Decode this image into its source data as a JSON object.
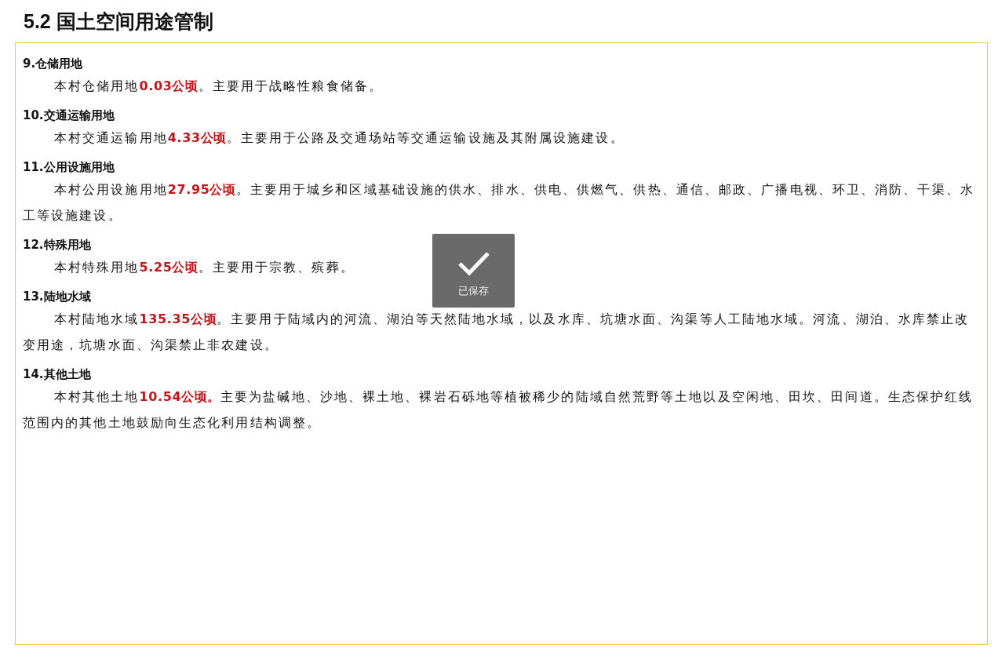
{
  "title": "5.2 国土空间用途管制",
  "sections": [
    {
      "heading": "9.仓储用地",
      "before": "本村仓储用地",
      "amount": "0.03公顷",
      "after": "。主要用于战略性粮食储备。"
    },
    {
      "heading": "10.交通运输用地",
      "before": "本村交通运输用地",
      "amount": "4.33公顷",
      "after": "。主要用于公路及交通场站等交通运输设施及其附属设施建设。"
    },
    {
      "heading": "11.公用设施用地",
      "before": "本村公用设施用地",
      "amount": "27.95公顷",
      "after": "。主要用于城乡和区域基础设施的供水、排水、供电、供燃气、供热、通信、邮政、广播电视、环卫、消防、干渠、水工等设施建设。"
    },
    {
      "heading": "12.特殊用地",
      "before": "本村特殊用地",
      "amount": "5.25公顷",
      "after": "。主要用于宗教、殡葬。"
    },
    {
      "heading": "13.陆地水域",
      "before": "本村陆地水域",
      "amount": "135.35公顷",
      "after": "。主要用于陆域内的河流、湖泊等天然陆地水域，以及水库、坑塘水面、沟渠等人工陆地水域。河流、湖泊、水库禁止改变用途，坑塘水面、沟渠禁止非农建设。"
    },
    {
      "heading": "14.其他土地",
      "before": "本村其他土地",
      "amount": "10.54公顷。",
      "after": "主要为盐碱地、沙地、裸土地、裸岩石砾地等植被稀少的陆域自然荒野等土地以及空闲地、田坎、田间道。生态保护红线范围内的其他土地鼓励向生态化利用结构调整。"
    }
  ],
  "toast": {
    "message": "已保存"
  }
}
